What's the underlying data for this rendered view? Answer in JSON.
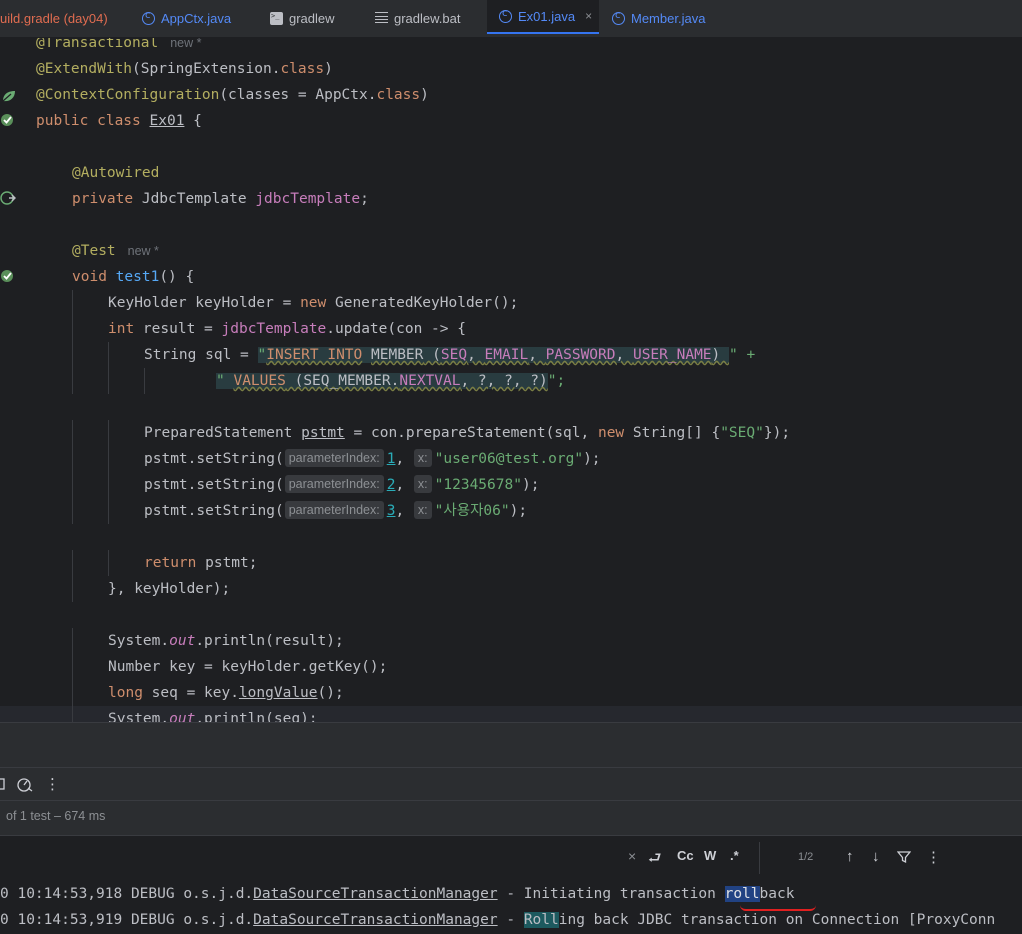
{
  "tabs": [
    {
      "label": "uild.gradle (day04)",
      "icon": "gradle-file-icon",
      "color": "#e06c50"
    },
    {
      "label": "AppCtx.java",
      "icon": "class-icon",
      "color": "#548af7"
    },
    {
      "label": "gradlew",
      "icon": "terminal-file-icon",
      "color": "#bcbec4"
    },
    {
      "label": "gradlew.bat",
      "icon": "text-file-icon",
      "color": "#bcbec4"
    },
    {
      "label": "Ex01.java",
      "icon": "class-icon",
      "color": "#548af7",
      "active": true,
      "close": "×"
    },
    {
      "label": "Member.java",
      "icon": "class-icon",
      "color": "#548af7"
    }
  ],
  "editor": {
    "inlay_new": "new *",
    "hint_param": "parameterIndex:",
    "hint_x": "x:",
    "l_transactional": "@Transactional",
    "l_extend_ann": "@ExtendWith",
    "l_extend_rest": "(SpringExtension.",
    "l_class_kw": "class",
    "l_close_paren": ")",
    "l_ctx_ann": "@ContextConfiguration",
    "l_ctx_rest": "(classes = AppCtx.",
    "l_public": "public class",
    "l_ex01": "Ex01",
    "l_brace": " {",
    "l_autowired": "@Autowired",
    "l_private": "private",
    "l_jdbc_type": " JdbcTemplate ",
    "l_jdbc_field": "jdbcTemplate",
    "l_semi": ";",
    "l_test": "@Test",
    "l_void": "void",
    "l_test1": "test1",
    "l_test1_rest": "() {",
    "l_kh": "KeyHolder keyHolder = ",
    "l_new": "new",
    "l_kh_rest": " GeneratedKeyHolder();",
    "l_int": "int",
    "l_result": " result = ",
    "l_update": ".update(con -> {",
    "l_string_sql": "String sql = ",
    "sql1_q": "\"",
    "sql1_insert": "INSERT INTO",
    "sql1_member": "MEMBER",
    "sql1_cols_open": " (",
    "sql1_seq": "SEQ",
    "sql1_c1": ", ",
    "sql1_email": "EMAIL",
    "sql1_c2": ", ",
    "sql1_password": "PASSWORD",
    "sql1_c3": ", ",
    "sql1_username": "USER_NAME",
    "sql1_close": ") ",
    "sql1_end": "\" +",
    "sql2_q": "\"",
    "sql2_values": "VALUES",
    "sql2_open": " (SEQ_MEMBER.",
    "sql2_nextval": "NEXTVAL",
    "sql2_rest": ", ?, ?, ?)",
    "sql2_end": "\";",
    "l_ps": "PreparedStatement ",
    "l_pstmt": "pstmt",
    "l_ps_mid": " = con.prepareStatement(sql, ",
    "l_ps_arr": " String[] {",
    "l_ps_seq": "\"SEQ\"",
    "l_ps_end": "});",
    "l_set": "pstmt.setString(",
    "p1_idx": "1",
    "p1_val": "\"user06@test.org\"",
    "p2_idx": "2",
    "p2_val": "\"12345678\"",
    "p3_idx": "3",
    "p3_val": "\"사용자06\"",
    "l_comma": ", ",
    "l_endcall": ");",
    "l_return": "return",
    "l_return_rest": " pstmt;",
    "l_close_lambda": "}, keyHolder);",
    "l_sys": "System.",
    "l_out": "out",
    "l_println_result": ".println(result);",
    "l_number_key": "Number key = keyHolder.getKey();",
    "l_long": "long",
    "l_seq_assign": " seq = key.",
    "l_longvalue": "longValue",
    "l_paren_semi": "();",
    "l_println_seq": ".println(seq);"
  },
  "status": {
    "tests": "of 1 test – 674 ms"
  },
  "find": {
    "close": "×",
    "regex_case": "Cc",
    "words": "W",
    "regex": ".*",
    "match_count": "1/2",
    "up": "↑",
    "down": "↓",
    "filter": "⊽",
    "more": "⋮",
    "wrap": "⮐"
  },
  "console": {
    "line1_prefix": "0 10:14:53,918 DEBUG o.s.j.d.",
    "line1_class": "DataSourceTransactionManager",
    "line1_mid": " - Initiating transaction ",
    "line1_match": "roll",
    "line1_end": "back",
    "line2_prefix": "0 10:14:53,919 DEBUG o.s.j.d.",
    "line2_class": "DataSourceTransactionManager",
    "line2_mid": " - ",
    "line2_match": "Roll",
    "line2_end": "ing back JDBC transaction on Connection [ProxyConn"
  },
  "colors": {
    "editor_bg": "#1e1f22",
    "panel_bg": "#2b2d30",
    "keyword": "#cf8e6d",
    "annotation": "#b3ae60",
    "string": "#6aab73",
    "field": "#c77dbb",
    "method": "#56a8f5",
    "accent": "#3574f0"
  }
}
